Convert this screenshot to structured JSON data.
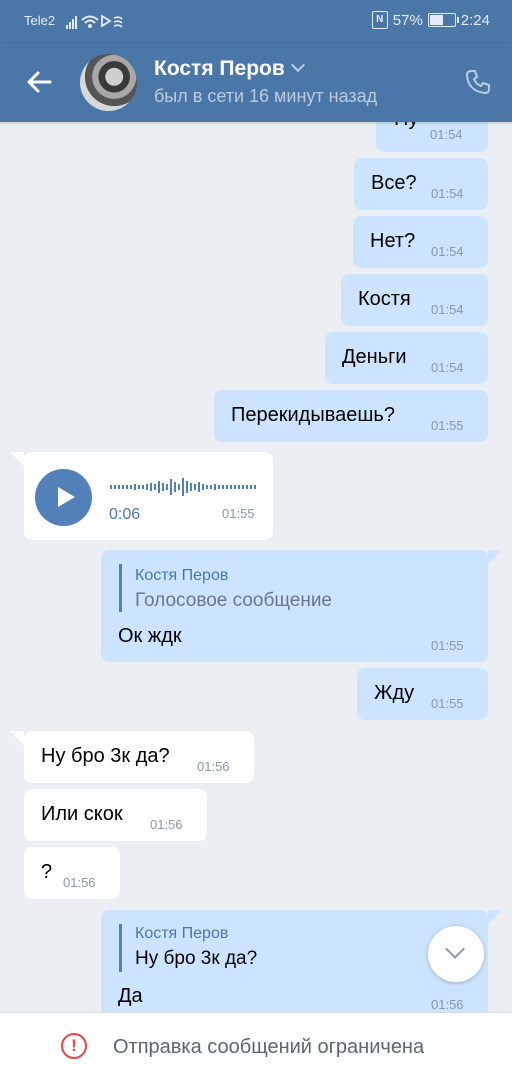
{
  "statusbar": {
    "carrier": "Tele2",
    "battery": "57%",
    "battery_level": 0.57,
    "time": "2:24"
  },
  "header": {
    "name": "Костя Перов",
    "status": "был в сети 16 минут назад"
  },
  "messages": [
    {
      "text": "Ну",
      "time": "01:54"
    },
    {
      "text": "Все?",
      "time": "01:54"
    },
    {
      "text": "Нет?",
      "time": "01:54"
    },
    {
      "text": "Костя",
      "time": "01:54"
    },
    {
      "text": "Деньги",
      "time": "01:54"
    },
    {
      "text": "Перекидываешь?",
      "time": "01:55"
    },
    {
      "voice_duration": "0:06",
      "time": "01:55"
    },
    {
      "reply_name": "Костя Перов",
      "reply_text": "Голосовое сообщение",
      "text": "Ок ждк",
      "time": "01:55"
    },
    {
      "text": "Жду",
      "time": "01:55"
    },
    {
      "text": "Ну бро 3к да?",
      "time": "01:56"
    },
    {
      "text": "Или скок",
      "time": "01:56"
    },
    {
      "text": "?",
      "time": "01:56"
    },
    {
      "reply_name": "Костя Перов",
      "reply_text": "Ну бро 3к да?",
      "text": "Да",
      "time": "01:56"
    }
  ],
  "footer": {
    "text": "Отправка сообщений ограничена"
  },
  "icons": {
    "back": "arrow-left-icon",
    "call": "phone-icon",
    "scroll": "chevron-down-icon",
    "warning": "exclamation-circle-icon",
    "play": "play-icon"
  },
  "colors": {
    "header": "#4a76a8",
    "outgoing_bubble": "#cce4ff",
    "incoming_bubble": "#ffffff",
    "background": "#ebeef2",
    "warning": "#e64646"
  }
}
